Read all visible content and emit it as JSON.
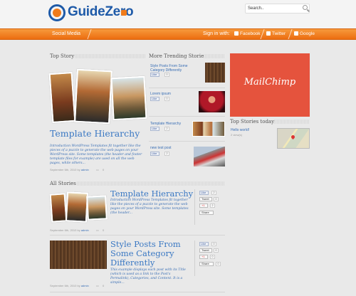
{
  "header": {
    "logo": "GuideZero",
    "search_placeholder": "Search.."
  },
  "nav": {
    "section": "Social Media",
    "sign_in": "Sign in with:",
    "facebook": "Facebook",
    "twitter": "Twitter",
    "google": "Google"
  },
  "top_story": {
    "heading": "Top Story",
    "title": "Template Hierarchy",
    "excerpt": "Introduction WordPress Templates fit together like the pieces of a puzzle to generate the web pages on your WordPress site. Some templates (the header and footer template files for example) are used on all the web pages, while others...",
    "date": "September 6th, 2010 by",
    "author": "admin",
    "comments": "0"
  },
  "trending": {
    "heading": "More Trending Stories",
    "items": [
      {
        "title": "Style Posts From Some Category Differently",
        "like": "Like",
        "count": "0"
      },
      {
        "title": "Lorem ipsum",
        "like": "Like",
        "count": "0"
      },
      {
        "title": "Template Hierarchy",
        "like": "Like",
        "count": "2"
      },
      {
        "title": "new test post",
        "like": "Like",
        "count": "2"
      }
    ]
  },
  "sidebar": {
    "ad": "MailChimp",
    "top_today_heading": "Top Stories today",
    "top_today": [
      {
        "title": "Hello world!",
        "meta": "2 view(s)"
      }
    ]
  },
  "all_stories": {
    "heading": "All Stories",
    "items": [
      {
        "title": "Template Hierarchy",
        "excerpt": "Introduction WordPress Templates fit together like the pieces of a puzzle to generate the web pages on your WordPress site. Some templates (the header...",
        "date": "September 6th, 2010 by",
        "author": "admin",
        "comments": "0",
        "like": "Like",
        "like_count": "2",
        "tweet": "Tweet",
        "tweet_count": "0",
        "plus": "+1",
        "plus_count": "2",
        "share": "Share"
      },
      {
        "title": "Style Posts From Some Category Differently",
        "excerpt": "This example displays each post with its Title (which is used as a link to the Post's Permalink), Categories, and Content. It is a simple...",
        "date": "September 6th, 2010 by",
        "author": "admin",
        "comments": "0",
        "like": "Like",
        "like_count": "0",
        "tweet": "Tweet",
        "tweet_count": "0",
        "plus": "+1",
        "plus_count": "0",
        "share": "Share",
        "share_count": "0"
      }
    ]
  },
  "colors": {
    "accent": "#f07b1a",
    "link": "#3a78c3",
    "ad_bg": "#e5533d"
  }
}
